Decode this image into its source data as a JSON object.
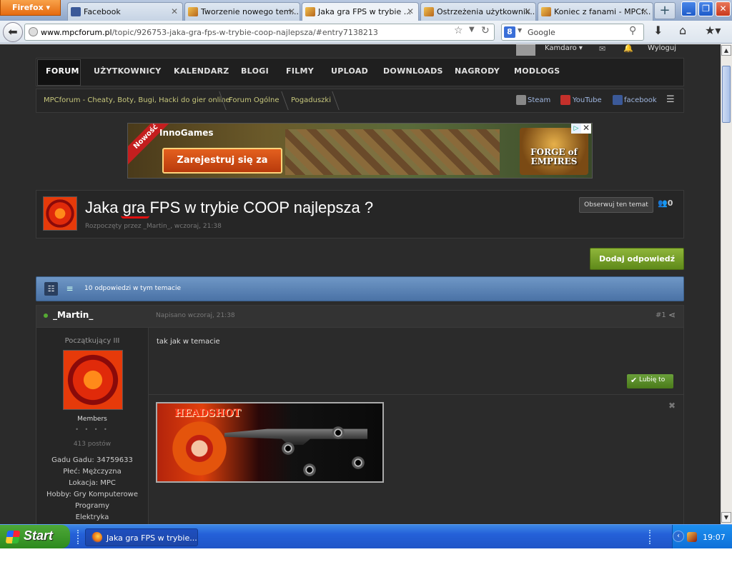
{
  "browser": {
    "menu_label": "Firefox",
    "tabs": [
      {
        "label": "Facebook",
        "favicon": "facebook-icon"
      },
      {
        "label": "Tworzenie nowego tem...",
        "favicon": "mpc-icon"
      },
      {
        "label": "Jaka gra FPS w trybie ...",
        "favicon": "mpc-icon",
        "active": true
      },
      {
        "label": "Ostrzeżenia użytkownik...",
        "favicon": "mpc-icon"
      },
      {
        "label": "Koniec z fanami - MPCf...",
        "favicon": "mpc-icon"
      }
    ],
    "url_host": "www.mpcforum.pl",
    "url_path": "/topic/926753-jaka-gra-fps-w-trybie-coop-najlepsza/#entry7138213",
    "search_placeholder": "Google"
  },
  "site": {
    "user_name": "Kamdaro",
    "logout": "Wyloguj",
    "nav": [
      "FORUM",
      "UŻYTKOWNICY",
      "KALENDARZ",
      "BLOGI",
      "FILMY",
      "UPLOAD",
      "DOWNLOADS",
      "NAGRODY",
      "MODLOGS"
    ],
    "breadcrumbs": [
      "MPCforum - Cheaty, Boty, Bugi, Hacki do gier online",
      "Forum Ogólne",
      "Pogaduszki"
    ],
    "social": [
      "Steam",
      "YouTube",
      "facebook"
    ]
  },
  "ad": {
    "ribbon": "Nowość",
    "brand": "InnoGames",
    "cta": "Zarejestruj się za darmo!",
    "game_line1": "FORGE of",
    "game_line2": "EMPIRES"
  },
  "topic": {
    "title": "Jaka gra FPS w trybie COOP najlepsza ?",
    "meta": "Rozpoczęty przez _Martin_, wczoraj, 21:38",
    "follow": "Obserwuj ten temat",
    "followers": "0",
    "reply": "Dodaj odpowiedź",
    "replies": "10 odpowiedzi w tym temacie"
  },
  "post": {
    "author": "_Martin_",
    "date": "Napisano wczoraj, 21:38",
    "number": "#1",
    "rank": "Początkujący III",
    "group": "Members",
    "pips": "• • • •",
    "posts": "413 postów",
    "fields": [
      "Gadu Gadu: 34759633",
      "Płeć: Mężczyzna",
      "Lokacja: MPC",
      "Hobby: Gry Komputerowe",
      "Programy",
      "Elektryka"
    ],
    "body": "tak jak w temacie",
    "like": "Lubię to",
    "sig_text": "HEADSHOT"
  },
  "taskbar": {
    "start": "Start",
    "item": "Jaka gra FPS w trybie...",
    "clock": "19:07"
  }
}
